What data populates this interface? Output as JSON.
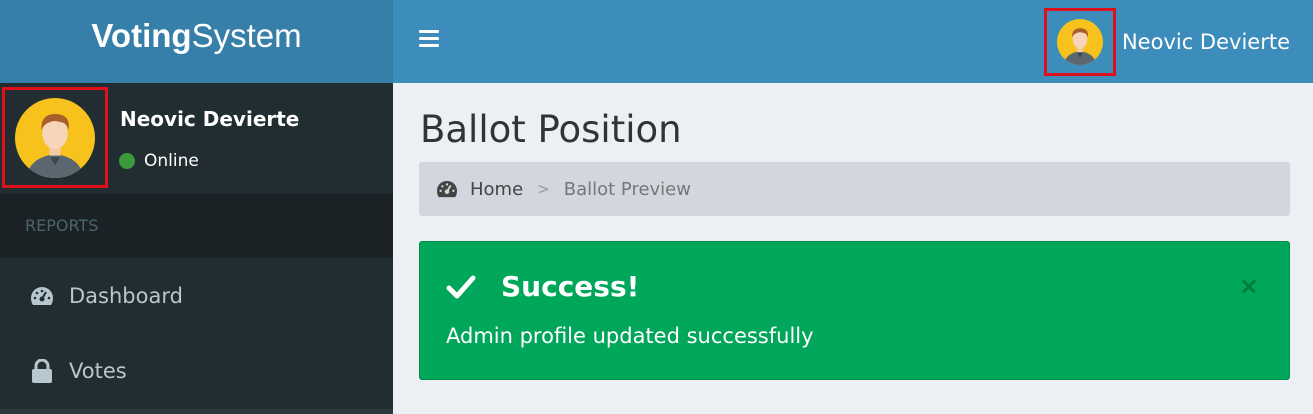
{
  "brand": {
    "bold": "Voting",
    "light": "System"
  },
  "header": {
    "user_name": "Neovic Devierte"
  },
  "sidebar": {
    "user_name": "Neovic Devierte",
    "status": "Online",
    "section_label": "REPORTS",
    "items": [
      {
        "label": "Dashboard",
        "icon": "dashboard-icon"
      },
      {
        "label": "Votes",
        "icon": "lock-icon"
      }
    ]
  },
  "content": {
    "title": "Ballot Position",
    "breadcrumb": {
      "home": "Home",
      "separator": ">",
      "current": "Ballot Preview"
    },
    "alert": {
      "title": "Success!",
      "message": "Admin profile updated successfully",
      "close": "×",
      "color": "#00a65a"
    }
  },
  "colors": {
    "header": "#3c8dbc",
    "logo_bg": "#367fa9",
    "sidebar": "#222d32",
    "highlight_box": "#e0101a"
  }
}
